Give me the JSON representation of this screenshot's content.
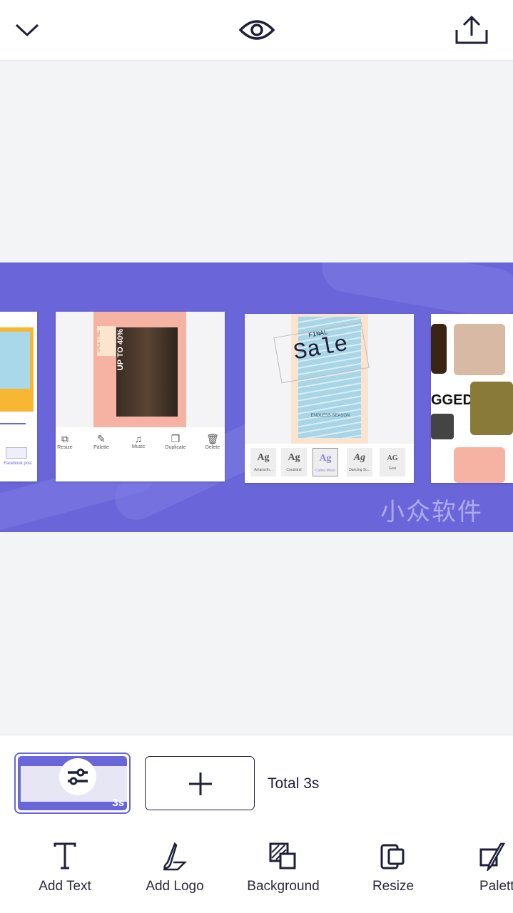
{
  "topbar": {
    "icons": [
      "chevron-down-icon",
      "eye-icon",
      "share-icon"
    ]
  },
  "canvas": {
    "watermark": "小众软件",
    "card_left": {
      "label": "Facebook post"
    },
    "card_main": {
      "poster_text": [
        "SALE TIME",
        "UP TO 40%"
      ],
      "tools": [
        {
          "label": "Resize",
          "icon": "resize-icon"
        },
        {
          "label": "Palette",
          "icon": "palette-icon"
        },
        {
          "label": "Music",
          "icon": "music-icon"
        },
        {
          "label": "Duplicate",
          "icon": "duplicate-icon"
        },
        {
          "label": "Delete",
          "icon": "trash-icon"
        }
      ]
    },
    "card_font": {
      "poster_small": "FINAL",
      "poster_big": "Sale",
      "poster_sub": "ENDLESS SEASON",
      "fonts": [
        {
          "sample": "Ag",
          "label": "Amaranth..."
        },
        {
          "sample": "Ag",
          "label": "Cousland"
        },
        {
          "sample": "Ag",
          "label": "Cutive Mono"
        },
        {
          "sample": "Ag",
          "label": "Dancing Sc..."
        },
        {
          "sample": "AG",
          "label": "Gosi"
        }
      ]
    },
    "card_right": {
      "text": "GGED"
    }
  },
  "timeline": {
    "thumb_duration": "3s",
    "total": "Total 3s"
  },
  "toolbar": [
    {
      "label": "Add Text",
      "icon": "text-icon"
    },
    {
      "label": "Add Logo",
      "icon": "brush-icon"
    },
    {
      "label": "Background",
      "icon": "background-icon"
    },
    {
      "label": "Resize",
      "icon": "resize-icon"
    },
    {
      "label": "Palette",
      "icon": "palette-icon"
    }
  ],
  "colors": {
    "accent": "#6a66da",
    "ink": "#1f1f3a"
  }
}
